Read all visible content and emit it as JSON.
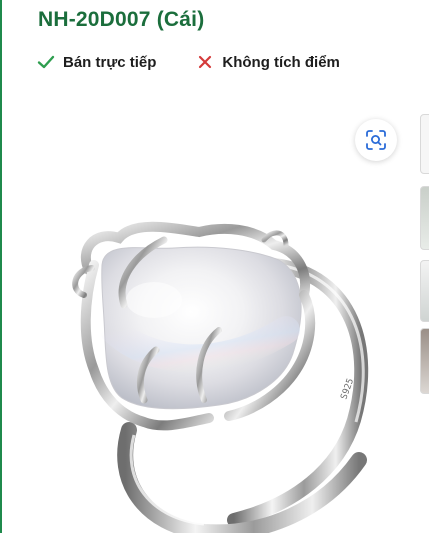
{
  "product": {
    "code_title": "NH-20D007 (Cái)"
  },
  "badges": [
    {
      "label": "Bán trực tiếp",
      "icon": "check-icon",
      "color": "#2e9e4f"
    },
    {
      "label": "Không tích điểm",
      "icon": "close-icon",
      "color": "#d43a3a"
    }
  ],
  "gallery": {
    "main_image": "pearl-ring-photo",
    "scan_button_icon": "scan-search-icon",
    "thumbnail_count_visible": 4
  },
  "colors": {
    "title_green": "#1b6e3c",
    "accent_green": "#2e9e4f",
    "accent_red": "#d43a3a"
  }
}
